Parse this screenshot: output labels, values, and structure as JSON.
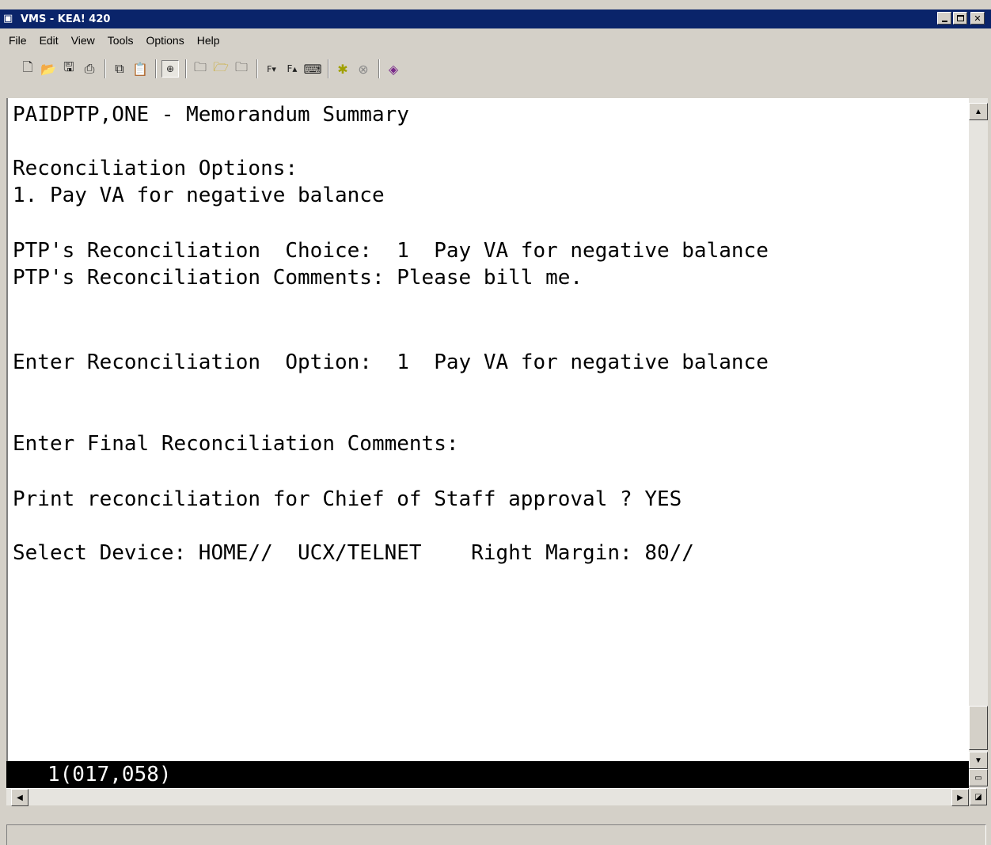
{
  "window": {
    "title": "VMS - KEA! 420",
    "app_icon": "terminal-icon"
  },
  "menu": {
    "items": [
      "File",
      "Edit",
      "View",
      "Tools",
      "Options",
      "Help"
    ]
  },
  "toolbar": {
    "icons": [
      "new-icon",
      "open-icon",
      "save-icon",
      "print-icon",
      "copy-icon",
      "paste-icon",
      "connect-icon",
      "folder-icon",
      "folder-up-icon",
      "folder-down-icon",
      "font-down-icon",
      "font-up-icon",
      "keyboard-icon",
      "traffic-light-icon",
      "stop-icon",
      "book-icon"
    ]
  },
  "terminal": {
    "lines": [
      "PAIDPTP,ONE - Memorandum Summary",
      "Reconciliation Options:",
      "1. Pay VA for negative balance",
      "PTP's Reconciliation  Choice:  1  Pay VA for negative balance",
      "PTP's Reconciliation Comments: Please bill me.",
      "Enter Reconciliation  Option:  1  Pay VA for negative balance",
      "Enter Final Reconciliation Comments:",
      "Print reconciliation for Chief of Staff approval ? YES",
      "Select Device: HOME//  UCX/TELNET    Right Margin: 80//"
    ],
    "status_line": "1(017,058)"
  }
}
